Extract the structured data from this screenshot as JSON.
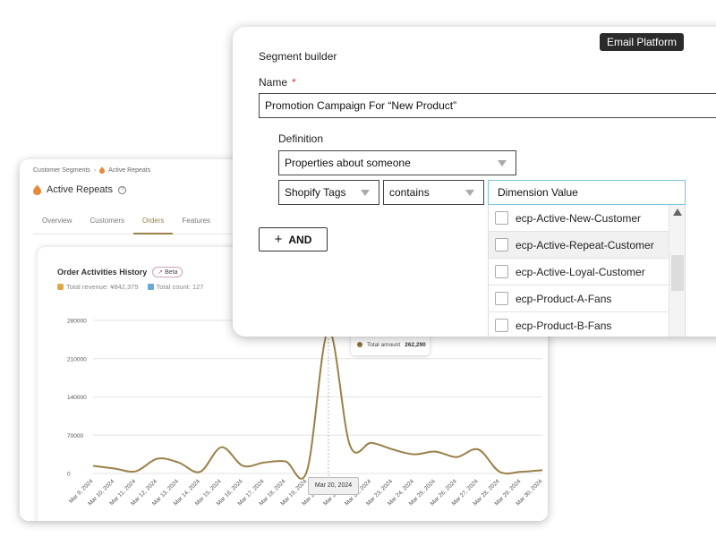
{
  "analytics": {
    "breadcrumb": {
      "root": "Customer Segments",
      "separator": "›",
      "current": "Active Repeats"
    },
    "page_title": "Active Repeats",
    "help_glyph": "?",
    "tabs": [
      {
        "label": "Overview",
        "active": false
      },
      {
        "label": "Customers",
        "active": false
      },
      {
        "label": "Orders",
        "active": true
      },
      {
        "label": "Features",
        "active": false
      }
    ],
    "chart_card": {
      "title": "Order Activities History",
      "beta_label": "Beta",
      "beta_icon": "rocket-icon",
      "total_revenue_label": "Total revenue:",
      "total_revenue_value": "¥842,375",
      "total_count_label": "Total count:",
      "total_count_value": "127"
    },
    "tooltip": {
      "series": "Total amount",
      "value": "262,290"
    },
    "x_tooltip": "Mar 20, 2024",
    "colors": {
      "accent": "#9a8048",
      "line": "#9a8048",
      "grid": "#e3e3e3"
    }
  },
  "chart_data": {
    "type": "line",
    "title": "Order Activities History",
    "series": [
      {
        "name": "Total amount",
        "values": [
          14000,
          9000,
          4000,
          27000,
          20000,
          3000,
          48000,
          14000,
          20000,
          22000,
          5000,
          262290,
          52000,
          56000,
          44000,
          35000,
          40000,
          30000,
          44000,
          3000,
          3000,
          6000
        ]
      }
    ],
    "x": [
      "Mar 9, 2024",
      "Mar 10, 2024",
      "Mar 11, 2024",
      "Mar 12, 2024",
      "Mar 13, 2024",
      "Mar 14, 2024",
      "Mar 15, 2024",
      "Mar 16, 2024",
      "Mar 17, 2024",
      "Mar 18, 2024",
      "Mar 19, 2024",
      "Mar 20, 2024",
      "Mar 21, 2024",
      "Mar 22, 2024",
      "Mar 23, 2024",
      "Mar 24, 2024",
      "Mar 25, 2024",
      "Mar 26, 2024",
      "Mar 27, 2024",
      "Mar 28, 2024",
      "Mar 29, 2024",
      "Mar 30, 2024"
    ],
    "y_ticks": [
      "0",
      "70000",
      "140000",
      "210000",
      "280000"
    ],
    "ylim": [
      0,
      280000
    ],
    "grid": true,
    "highlight_index": 11
  },
  "segment_builder": {
    "platform_badge": "Email Platform",
    "title": "Segment builder",
    "name_label": "Name",
    "required_mark": "*",
    "name_value": "Promotion Campaign For “New Product”",
    "definition_label": "Definition",
    "properties_select": "Properties about someone",
    "dimension_select": "Shopify Tags",
    "operator_select": "contains",
    "value_placeholder": "Dimension Value",
    "and_button": "AND",
    "and_plus": "+",
    "dropdown_options": [
      {
        "label": "ecp-Active-New-Customer",
        "hovered": false
      },
      {
        "label": "ecp-Active-Repeat-Customer",
        "hovered": true
      },
      {
        "label": "ecp-Active-Loyal-Customer",
        "hovered": false
      },
      {
        "label": "ecp-Product-A-Fans",
        "hovered": false
      },
      {
        "label": "ecp-Product-B-Fans",
        "hovered": false
      }
    ]
  }
}
